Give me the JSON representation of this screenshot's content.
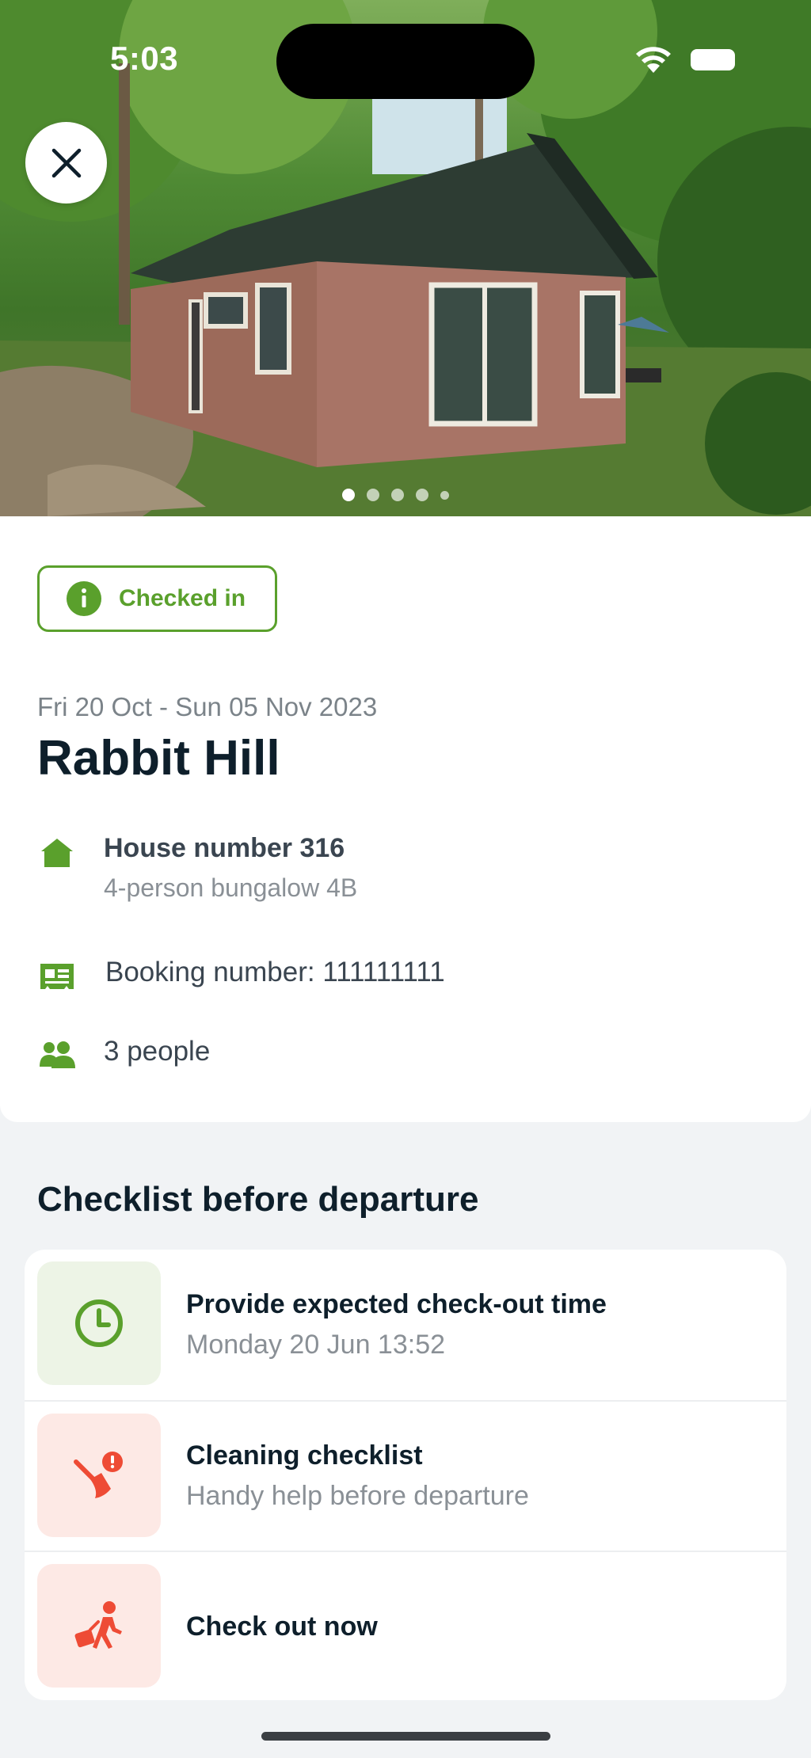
{
  "status_bar": {
    "time": "5:03"
  },
  "hero": {
    "photo_count": 5,
    "active_index": 0
  },
  "booking": {
    "status_badge": "Checked in",
    "dates": "Fri 20 Oct - Sun 05 Nov 2023",
    "park_name": "Rabbit Hill",
    "house_title": "House number 316",
    "house_type": "4-person bungalow 4B",
    "booking_number": "Booking number: 111111111",
    "guests": "3 people"
  },
  "checklist": {
    "title": "Checklist before departure",
    "items": [
      {
        "title": "Provide expected check-out time",
        "subtitle": "Monday 20 Jun 13:52",
        "icon": "clock-icon"
      },
      {
        "title": "Cleaning checklist",
        "subtitle": "Handy help before departure",
        "icon": "broom-alert-icon"
      },
      {
        "title": "Check out now",
        "icon": "person-luggage-icon"
      }
    ]
  },
  "colors": {
    "accent_green": "#5aa02c",
    "accent_red": "#ee4b35",
    "text_dark": "#0e1f2b",
    "text_muted": "#8a9096"
  }
}
